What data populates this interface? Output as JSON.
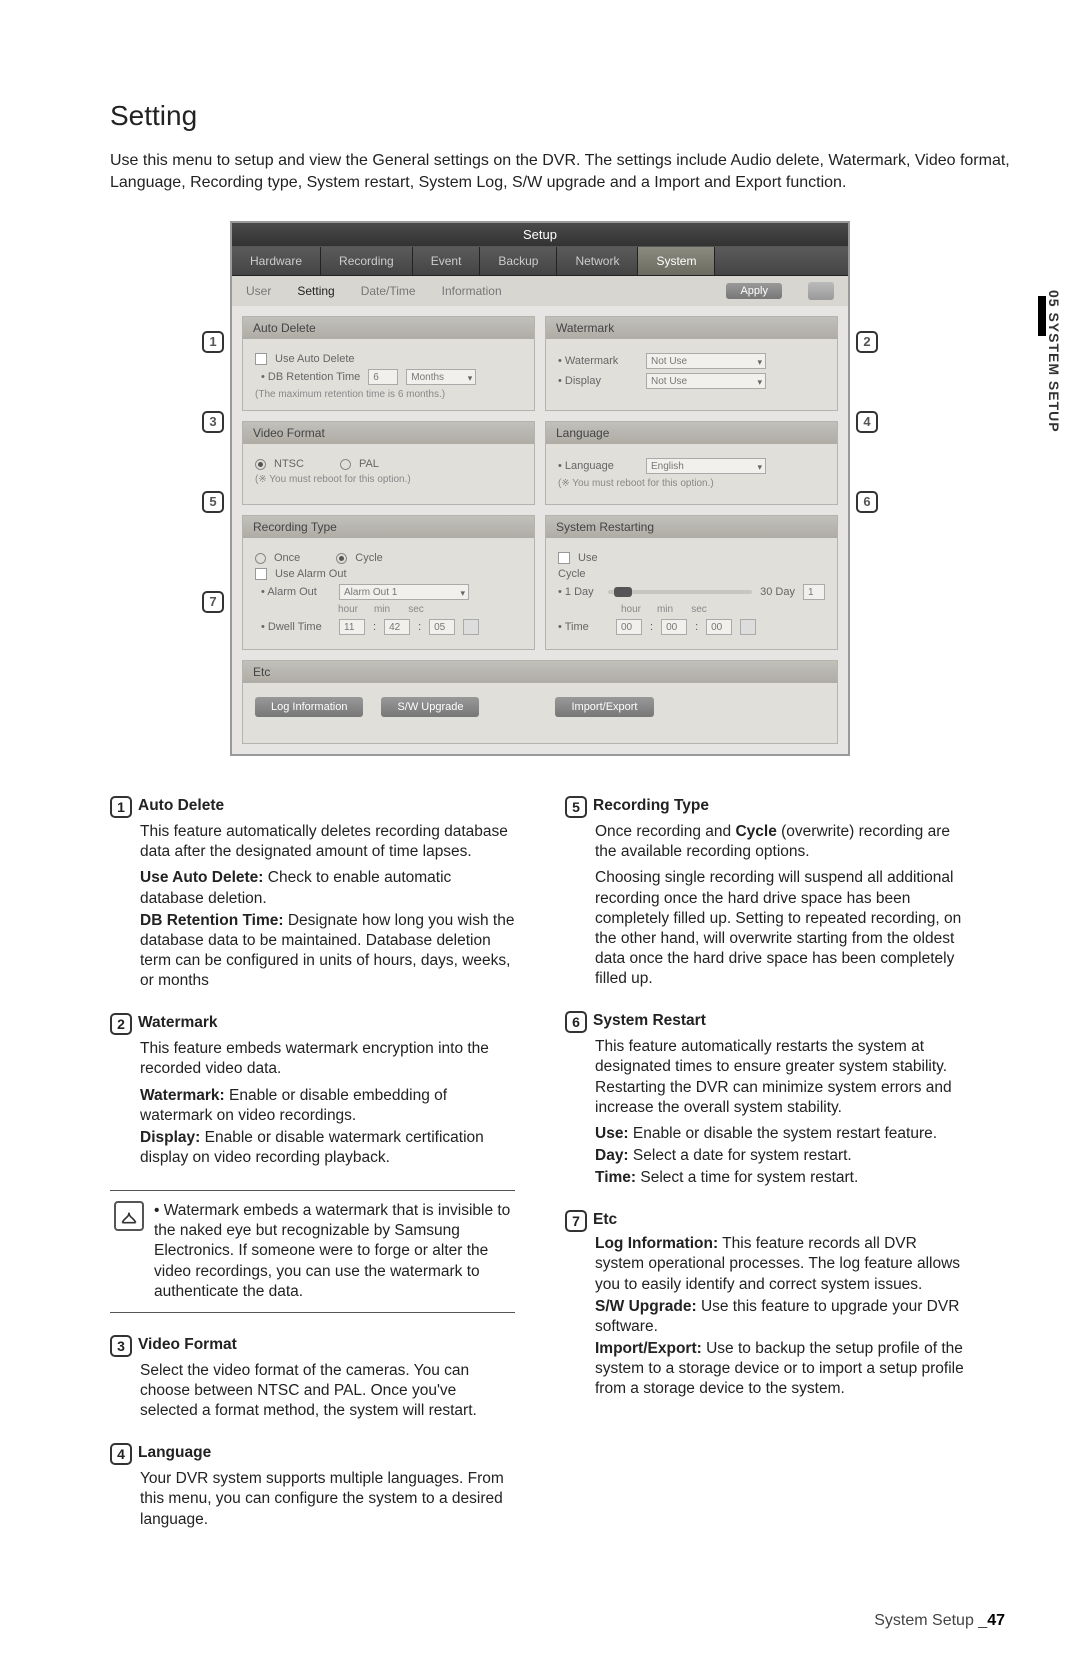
{
  "sideTab": "05 SYSTEM SETUP",
  "pageTitle": "Setting",
  "intro": "Use this menu to setup and view the General settings on the DVR. The settings include Audio delete, Watermark, Video format, Language, Recording type, System restart, System Log, S/W upgrade and a Import and Export function.",
  "window": {
    "title": "Setup",
    "tabs": [
      "Hardware",
      "Recording",
      "Event",
      "Backup",
      "Network",
      "System"
    ],
    "activeTab": "System",
    "subnav": [
      "User",
      "Setting",
      "Date/Time",
      "Information"
    ],
    "subnavActive": "Setting",
    "applyBtn": "Apply"
  },
  "panels": {
    "autoDelete": {
      "title": "Auto Delete",
      "chkLabel": "Use Auto Delete",
      "dbLabel": "DB Retention Time",
      "dbValue": "6",
      "dbUnit": "Months",
      "note": "(The maximum retention time is 6 months.)"
    },
    "watermark": {
      "title": "Watermark",
      "watermarkLabel": "Watermark",
      "watermarkVal": "Not Use",
      "displayLabel": "Display",
      "displayVal": "Not Use"
    },
    "videoFormat": {
      "title": "Video Format",
      "ntsc": "NTSC",
      "pal": "PAL",
      "note": "(※ You must reboot for this option.)"
    },
    "language": {
      "title": "Language",
      "label": "Language",
      "value": "English",
      "note": "(※ You must reboot for this option.)"
    },
    "recType": {
      "title": "Recording Type",
      "once": "Once",
      "cycle": "Cycle",
      "useAlarmOut": "Use Alarm Out",
      "alarmOutLabel": "Alarm Out",
      "alarmOutVal": "Alarm Out 1",
      "dwellLabel": "Dwell Time",
      "hour": "hour",
      "min": "min",
      "sec": "sec",
      "dwHour": "11",
      "dwMin": "42",
      "dwSec": "05"
    },
    "restart": {
      "title": "System Restarting",
      "useLabel": "Use",
      "cycleLabel": "Cycle",
      "sliderLeft": "1 Day",
      "sliderRight": "30 Day",
      "sliderVal": "1",
      "timeLabel": "Time",
      "tHour": "00",
      "tMin": "00",
      "tSec": "00"
    },
    "etc": {
      "title": "Etc",
      "logBtn": "Log Information",
      "swBtn": "S/W Upgrade",
      "ieBtn": "Import/Export"
    }
  },
  "desc": {
    "d1": {
      "title": "Auto Delete",
      "body": "This feature automatically deletes recording database data after the designated amount of time lapses.",
      "useLabel": "Use Auto Delete:",
      "useText": "Check to enable automatic database deletion.",
      "dbLabel": "DB Retention Time:",
      "dbText": "Designate how long you wish the database data to be maintained. Database deletion term can be configured in units of hours, days, weeks, or months"
    },
    "d2": {
      "title": "Watermark",
      "body": "This feature embeds watermark encryption into the recorded video data.",
      "wmLabel": "Watermark:",
      "wmText": "Enable or disable embedding of watermark on video recordings.",
      "dpLabel": "Display:",
      "dpText": "Enable or disable watermark certification display on video recording playback."
    },
    "note": "Watermark embeds a watermark that is invisible to the naked eye but recognizable by Samsung Electronics. If someone were to forge or alter the video recordings, you can use the watermark to authenticate the data.",
    "d3": {
      "title": "Video Format",
      "body": "Select the video format of the cameras. You can choose between NTSC and PAL. Once you've selected a format method, the system will restart."
    },
    "d4": {
      "title": "Language",
      "body": "Your DVR system supports multiple languages. From this menu, you can configure the system to a desired language."
    },
    "d5": {
      "title": "Recording Type",
      "body1a": "Once recording and ",
      "cycle": "Cycle",
      "body1b": " (overwrite) recording are the available recording options.",
      "body2": "Choosing single recording will suspend all additional recording once the hard drive space has been completely filled up. Setting to repeated recording, on the other hand, will overwrite starting from the oldest data once the hard drive space has been completely filled up."
    },
    "d6": {
      "title": "System Restart",
      "body": "This feature automatically restarts the system at designated times to ensure greater system stability. Restarting the DVR can minimize system errors and increase the overall system stability.",
      "useLabel": "Use:",
      "useText": "Enable or disable the system restart feature.",
      "dayLabel": "Day:",
      "dayText": "Select a date for system restart.",
      "timeLabel": "Time:",
      "timeText": "Select a time for system restart."
    },
    "d7": {
      "title": "Etc",
      "logLabel": "Log Information:",
      "logText": "This feature records all DVR system operational processes. The log feature allows you to easily identify and correct system issues.",
      "swLabel": "S/W Upgrade:",
      "swText": "Use this feature to upgrade your DVR software.",
      "ieLabel": "Import/Export:",
      "ieText": "Use to backup the setup profile of the system to a storage device or to import a setup profile from a storage device to the system."
    }
  },
  "footer": {
    "label": "System Setup _",
    "page": "47"
  }
}
